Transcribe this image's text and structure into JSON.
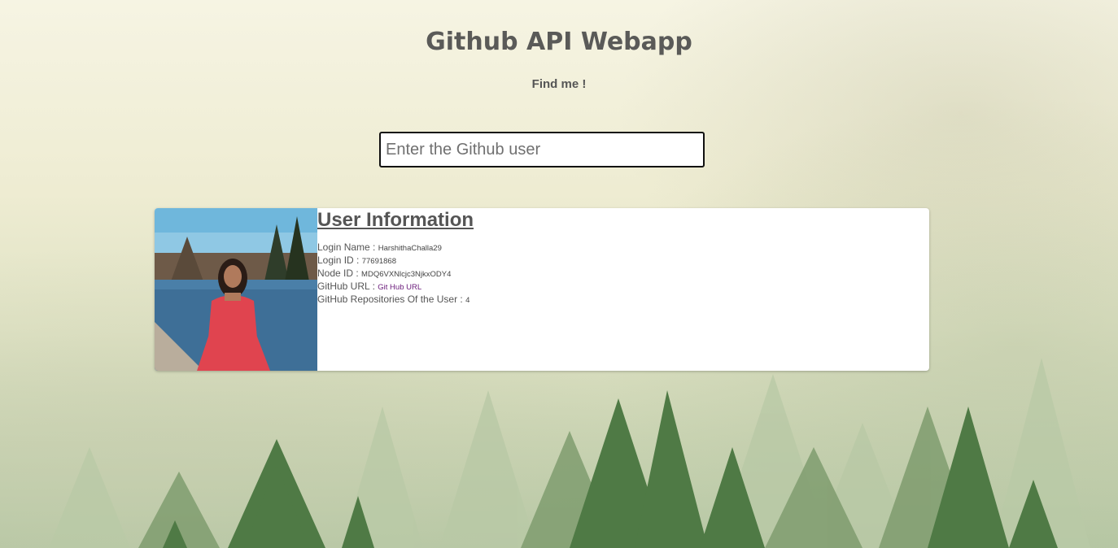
{
  "header": {
    "title": "Github API Webapp",
    "subtitle": "Find me !"
  },
  "search": {
    "placeholder": "Enter the Github user",
    "value": ""
  },
  "user_card": {
    "heading": "User Information",
    "avatar_icon": "user-avatar-photo",
    "fields": {
      "login_name_label": "Login Name :",
      "login_name_value": "HarshithaChalla29",
      "login_id_label": "Login ID :",
      "login_id_value": "77691868",
      "node_id_label": "Node ID :",
      "node_id_value": "MDQ6VXNlcjc3NjkxODY4",
      "github_url_label": "GitHub URL :",
      "github_url_link_text": "Git Hub URL",
      "repos_label": "GitHub Repositories Of the User :",
      "repos_value": "4"
    }
  },
  "colors": {
    "text": "#555555",
    "link": "#6a1b7a",
    "card_bg": "#ffffff",
    "input_border": "#111111"
  }
}
